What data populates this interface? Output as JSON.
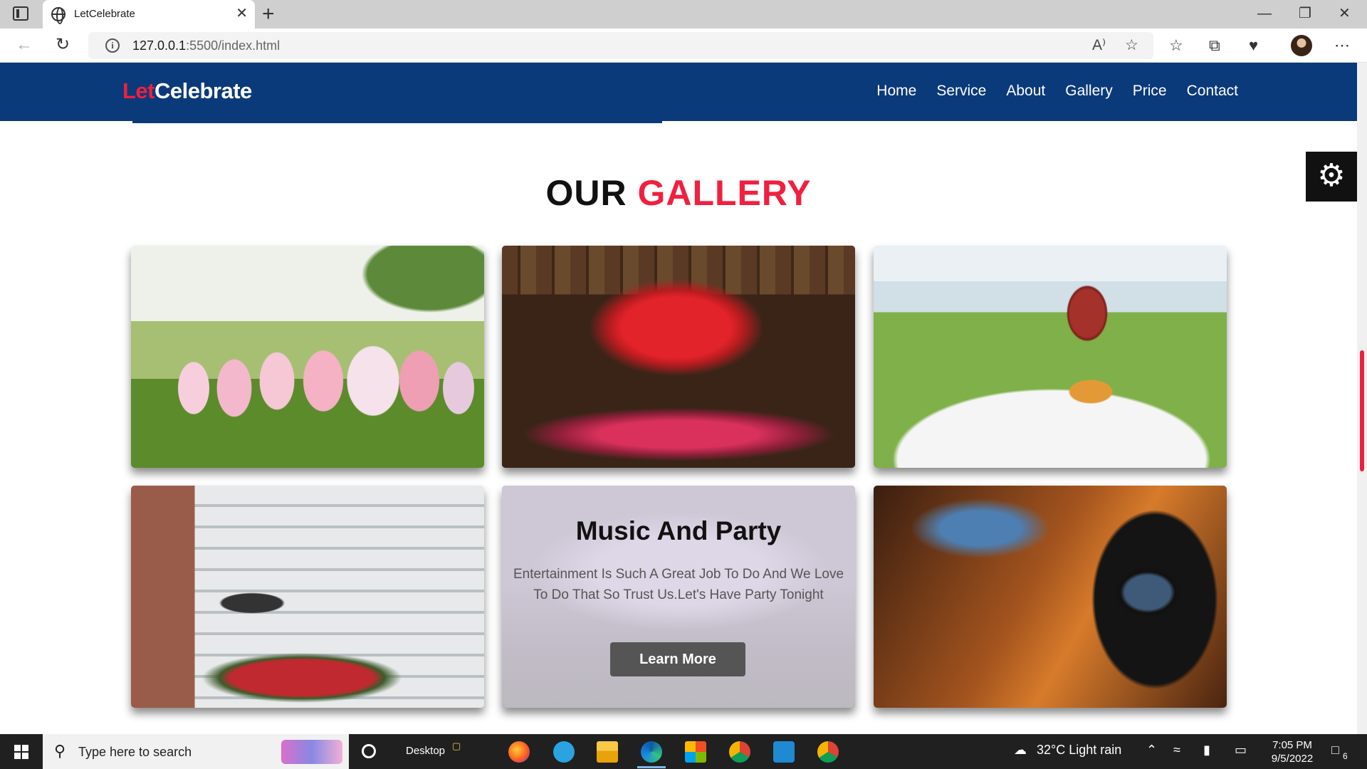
{
  "browser": {
    "tab_title": "LetCelebrate",
    "tab_close": "✕",
    "new_tab": "+",
    "url_host": "127.0.0.1",
    "url_rest": ":5500/index.html",
    "window_controls": {
      "minimize": "—",
      "restore": "❐",
      "close": "✕"
    },
    "nav": {
      "back": "←",
      "reload": "↻"
    },
    "toolbar": {
      "read_aloud": "A⁾",
      "add_favorite": "☆",
      "favorites": "☆",
      "collections": "⧉",
      "health": "♥",
      "more": "⋯"
    }
  },
  "site": {
    "logo_accent": "Let",
    "logo_rest": "Celebrate",
    "nav": [
      "Home",
      "Service",
      "About",
      "Gallery",
      "Price",
      "Contact"
    ],
    "settings_icon": "⚙"
  },
  "gallery": {
    "title_main": "OUR ",
    "title_accent": "GALLERY",
    "promo": {
      "title": "Music And Party",
      "text": "Entertainment Is Such A Great Job To Do And We Love To Do That So Trust Us.Let's Have Party Tonight",
      "button": "Learn More"
    }
  },
  "taskbar": {
    "search_placeholder": "Type here to search",
    "desktop_label": "Desktop",
    "weather": "32°C  Light rain",
    "time": "7:05 PM",
    "date": "9/5/2022",
    "notifications": "6",
    "apps": [
      "firefox",
      "telegram",
      "file-explorer",
      "edge",
      "microsoft-store",
      "chrome",
      "vscode",
      "chrome-profile"
    ]
  }
}
